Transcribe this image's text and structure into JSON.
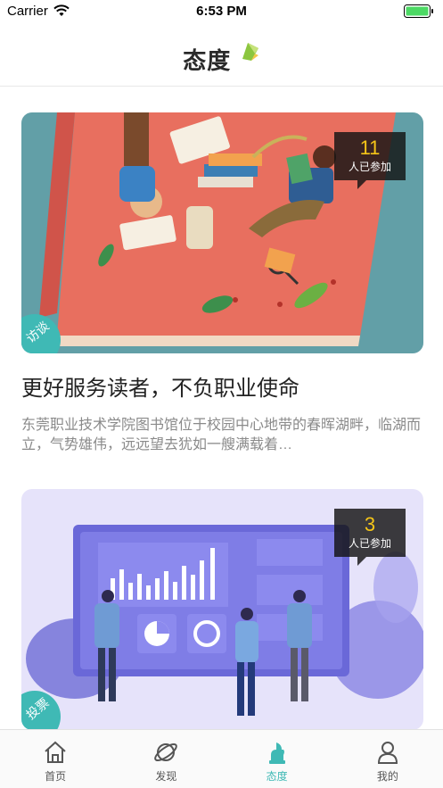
{
  "status_bar": {
    "carrier": "Carrier",
    "time": "6:53 PM"
  },
  "nav": {
    "title": "态度"
  },
  "cards": [
    {
      "count": "11",
      "count_label": "人已参加",
      "tag": "访谈",
      "title": "更好服务读者，不负职业使命",
      "description": "东莞职业技术学院图书馆位于校园中心地带的春晖湖畔，临湖而立，气势雄伟，远远望去犹如一艘满载着…"
    },
    {
      "count": "3",
      "count_label": "人已参加",
      "tag": "投票",
      "title": "",
      "description": ""
    }
  ],
  "tabs": [
    {
      "label": "首页",
      "icon": "home-icon"
    },
    {
      "label": "发现",
      "icon": "planet-icon"
    },
    {
      "label": "态度",
      "icon": "attitude-icon"
    },
    {
      "label": "我的",
      "icon": "user-icon"
    }
  ],
  "colors": {
    "accent": "#3fb9b5",
    "count": "#f5c518",
    "status_green": "#4cd964"
  }
}
